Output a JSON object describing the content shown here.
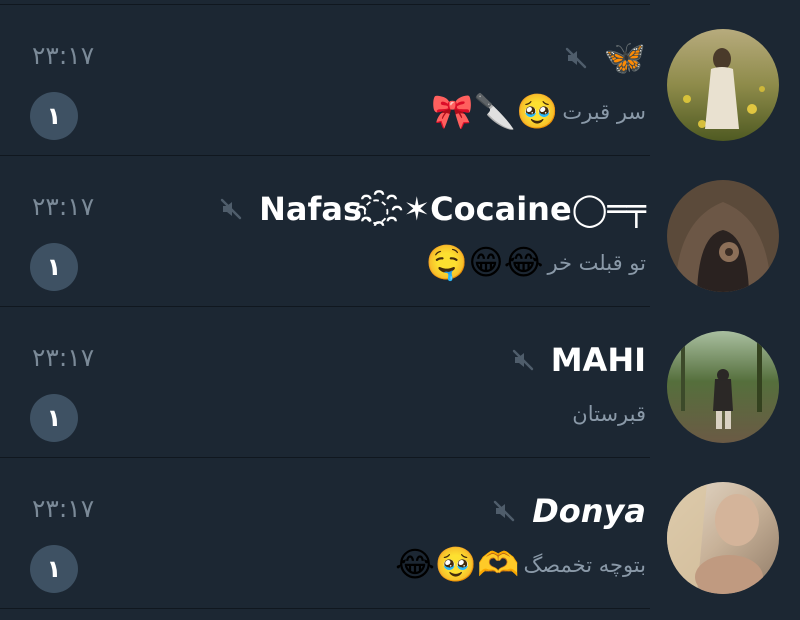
{
  "chats": [
    {
      "name": "🦋",
      "muted": true,
      "time": "۲۳:۱۷",
      "preview_text": "سر قبرت",
      "preview_emoji": "🎀🔪🥹",
      "unread": "۱",
      "avatar_icon": "avatar-photo-field"
    },
    {
      "name": "Nafas◌҈✶Cocaine◯═╤",
      "muted": true,
      "time": "۲۳:۱۷",
      "preview_text": "تو قبلت خر",
      "preview_emoji": "🤤😁😂",
      "unread": "۱",
      "avatar_icon": "avatar-photo-hood"
    },
    {
      "name": "MAHI",
      "muted": true,
      "time": "۲۳:۱۷",
      "preview_text": "قبرستان",
      "preview_emoji": "",
      "unread": "۱",
      "avatar_icon": "avatar-photo-forest"
    },
    {
      "name": "Donya",
      "muted": true,
      "time": "۲۳:۱۷",
      "preview_text": "بتوچه تخمصگ",
      "preview_emoji": "😂🥹🫶",
      "unread": "۱",
      "avatar_icon": "avatar-photo-portrait"
    }
  ],
  "colors": {
    "background": "#1c2733",
    "badge": "#3e5163",
    "secondary_text": "#7b8a98"
  }
}
